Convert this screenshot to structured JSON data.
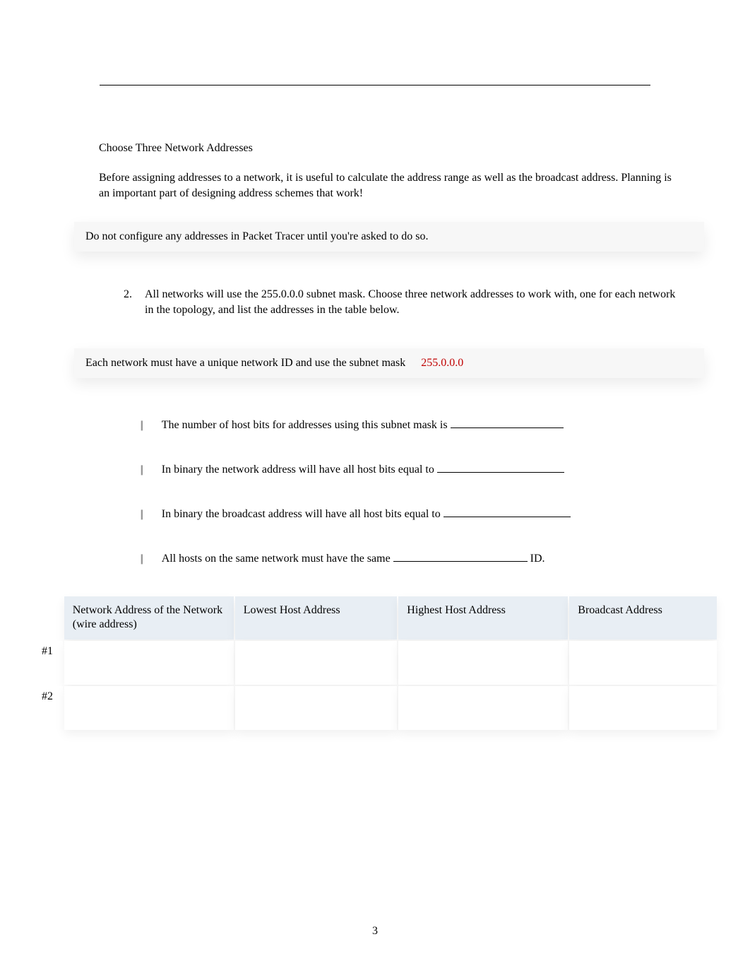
{
  "section": {
    "title": "Choose Three Network Addresses",
    "intro": "Before assigning addresses to a network, it is useful to calculate the address range as well as the broadcast address.   Planning is an important part of designing address schemes that work!"
  },
  "note1": "Do not configure any addresses in Packet Tracer until you're asked to do so.",
  "item2": {
    "number": "2.",
    "text": "All networks will use the 255.0.0.0 subnet mask.  Choose three network addresses to work with, one for each network in the topology, and list the addresses in the table below."
  },
  "note2": {
    "prefix": "Each network must have a unique network ID and use the subnet mask",
    "mask": "255.0.0.0"
  },
  "bullets": {
    "b1": "The number of host bits for addresses using this subnet mask is ",
    "b2": "In binary the network address will have all host bits equal to ",
    "b3": "In binary the broadcast address will have all host bits equal to ",
    "b4_prefix": "All hosts on the same network must have the same ",
    "b4_suffix": " ID."
  },
  "table": {
    "headers": {
      "net": "Network Address of the Network\n(wire address)",
      "low": "Lowest Host Address",
      "high": "Highest Host Address",
      "bcast": "Broadcast Address"
    },
    "rows": {
      "r1": "#1",
      "r2": "#2"
    }
  },
  "page_number": "3"
}
